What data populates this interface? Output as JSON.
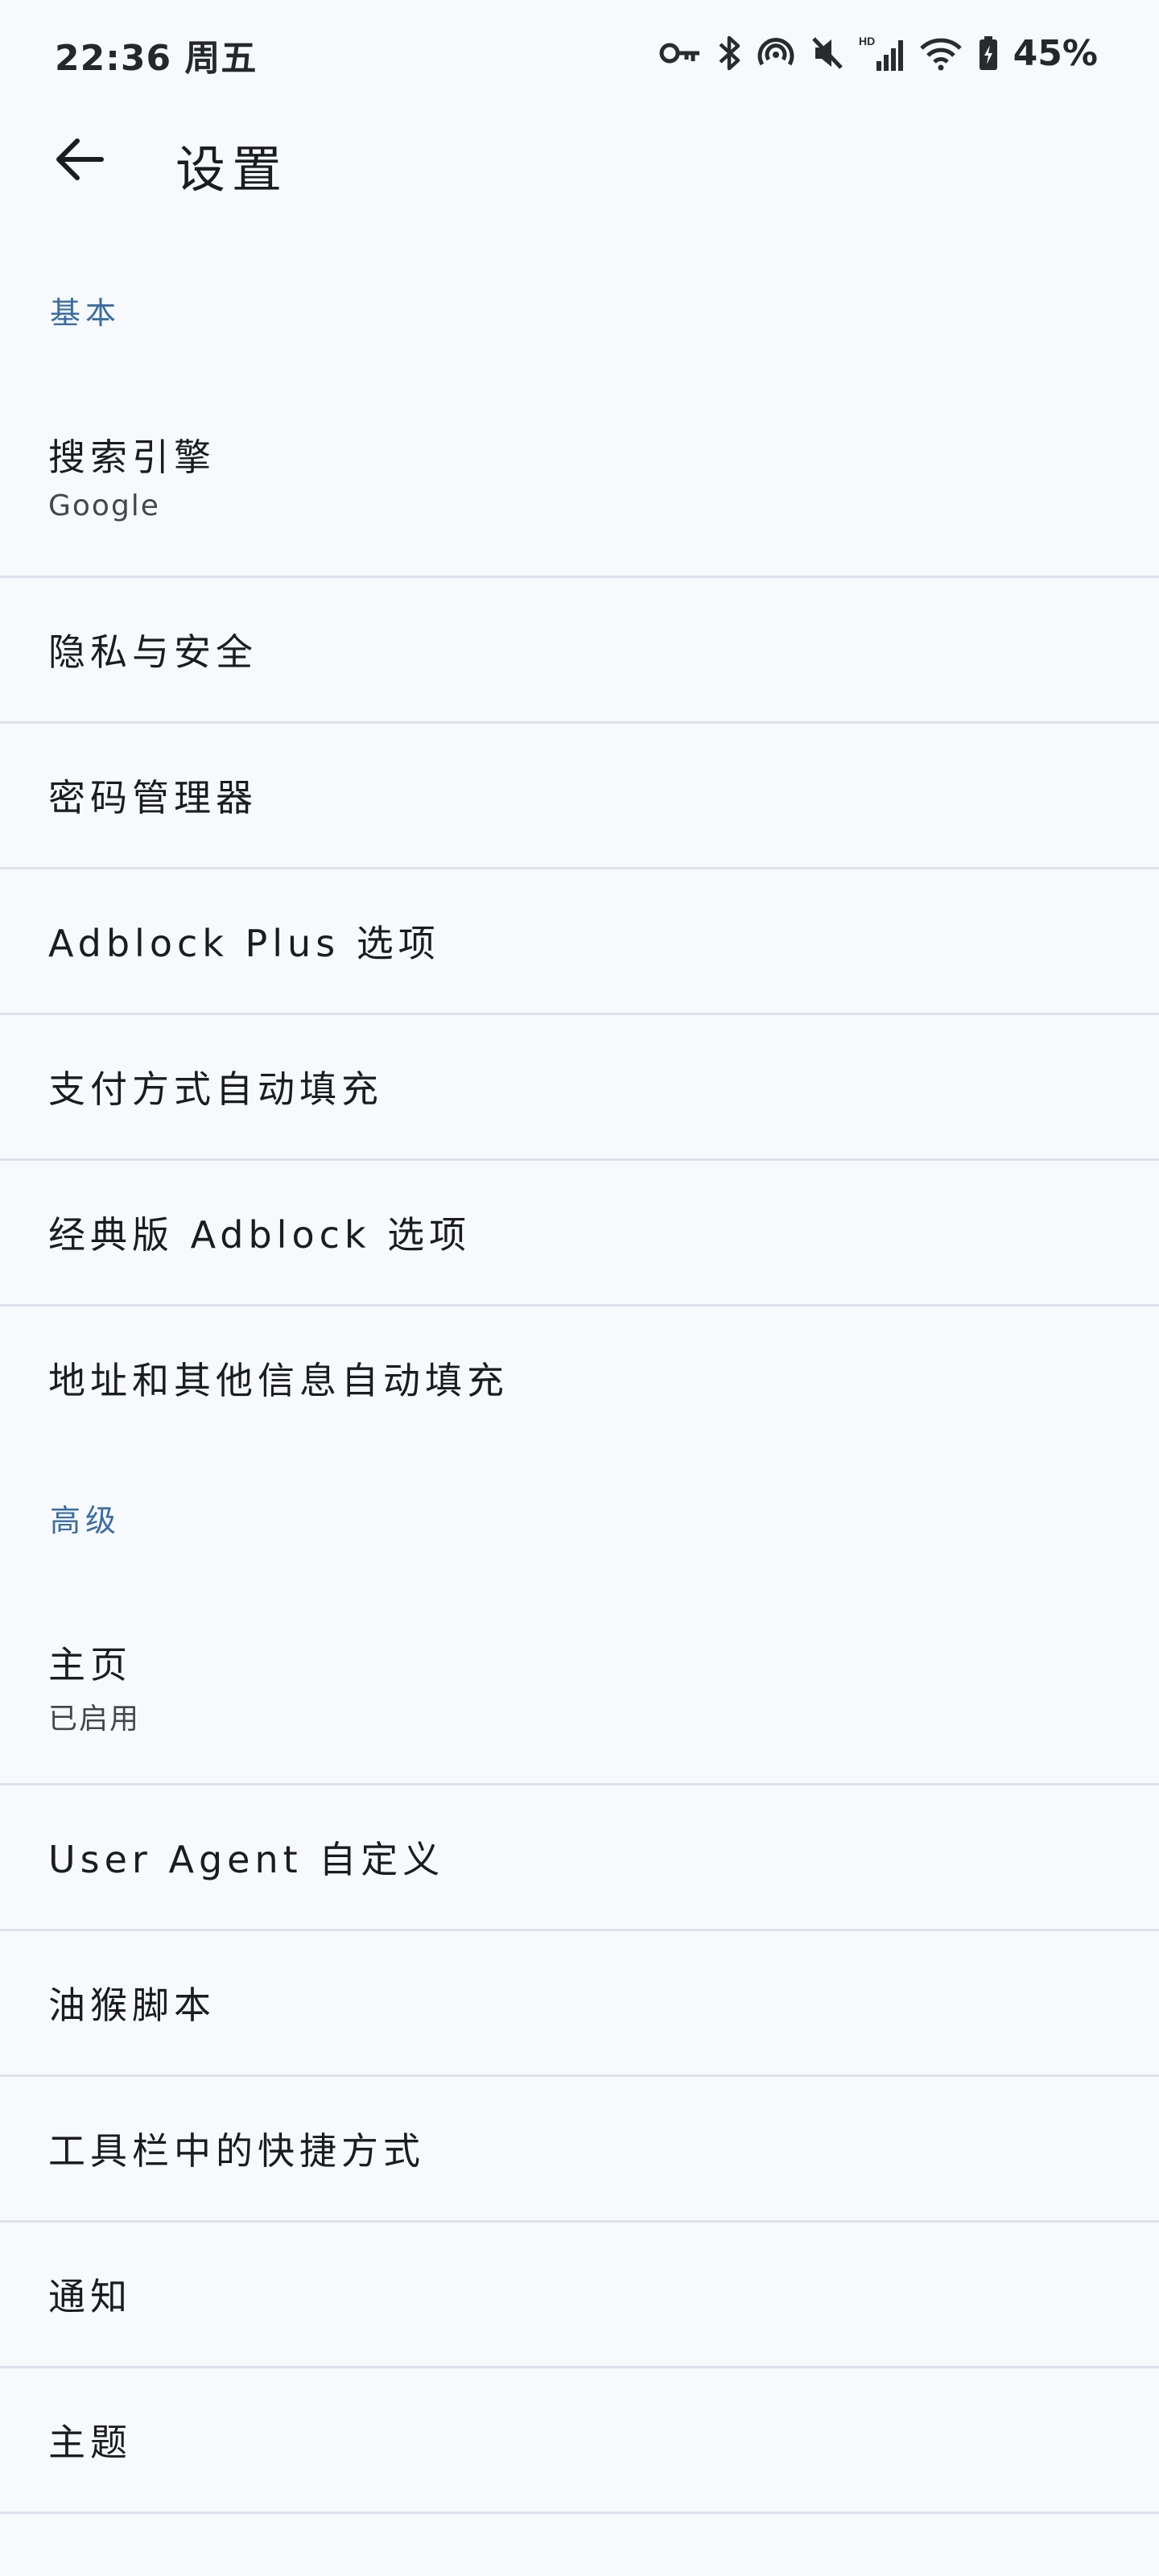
{
  "status_bar": {
    "time": "22:36 周五",
    "battery": "45%"
  },
  "app_bar": {
    "title": "设置"
  },
  "sections": {
    "basic": {
      "header": "基本",
      "items": [
        {
          "title": "搜索引擎",
          "subtitle": "Google"
        },
        {
          "title": "隐私与安全"
        },
        {
          "title": "密码管理器"
        },
        {
          "title": "Adblock Plus 选项"
        },
        {
          "title": "支付方式自动填充"
        },
        {
          "title": "经典版 Adblock 选项"
        },
        {
          "title": "地址和其他信息自动填充"
        }
      ]
    },
    "advanced": {
      "header": "高级",
      "items": [
        {
          "title": "主页",
          "subtitle": "已启用"
        },
        {
          "title": "User Agent 自定义"
        },
        {
          "title": "油猴脚本"
        },
        {
          "title": "工具栏中的快捷方式"
        },
        {
          "title": "通知"
        },
        {
          "title": "主题"
        }
      ]
    }
  }
}
